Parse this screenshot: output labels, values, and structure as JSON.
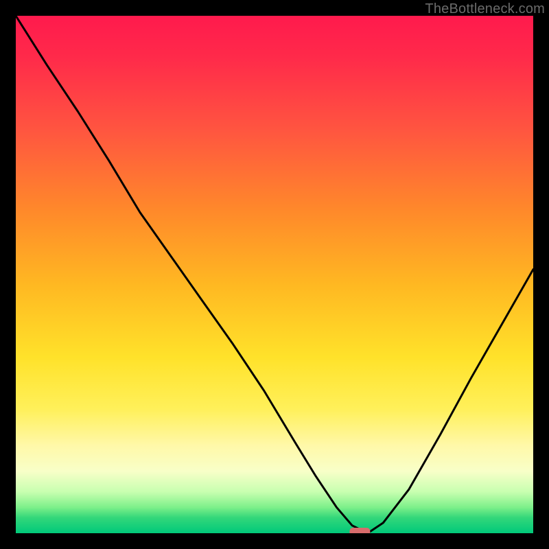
{
  "watermark": "TheBottleneck.com",
  "chart_data": {
    "type": "line",
    "title": "",
    "xlabel": "",
    "ylabel": "",
    "xlim": [
      0,
      1
    ],
    "ylim": [
      0,
      1
    ],
    "notes": "Background is a vertical red→green gradient representing bottleneck severity. The black curve is a V-shaped line with its minimum near x≈0.66.",
    "minimum_marker": {
      "x": 0.665,
      "y": 0.0,
      "color": "#d86c6c"
    },
    "series": [
      {
        "name": "bottleneck-curve",
        "x": [
          0.0,
          0.06,
          0.12,
          0.18,
          0.24,
          0.3,
          0.36,
          0.42,
          0.48,
          0.54,
          0.58,
          0.62,
          0.65,
          0.68,
          0.71,
          0.76,
          0.82,
          0.88,
          0.94,
          1.0
        ],
        "values": [
          1.0,
          0.905,
          0.815,
          0.72,
          0.62,
          0.535,
          0.45,
          0.365,
          0.275,
          0.175,
          0.11,
          0.05,
          0.015,
          0.0,
          0.02,
          0.085,
          0.19,
          0.3,
          0.405,
          0.51
        ]
      }
    ]
  }
}
